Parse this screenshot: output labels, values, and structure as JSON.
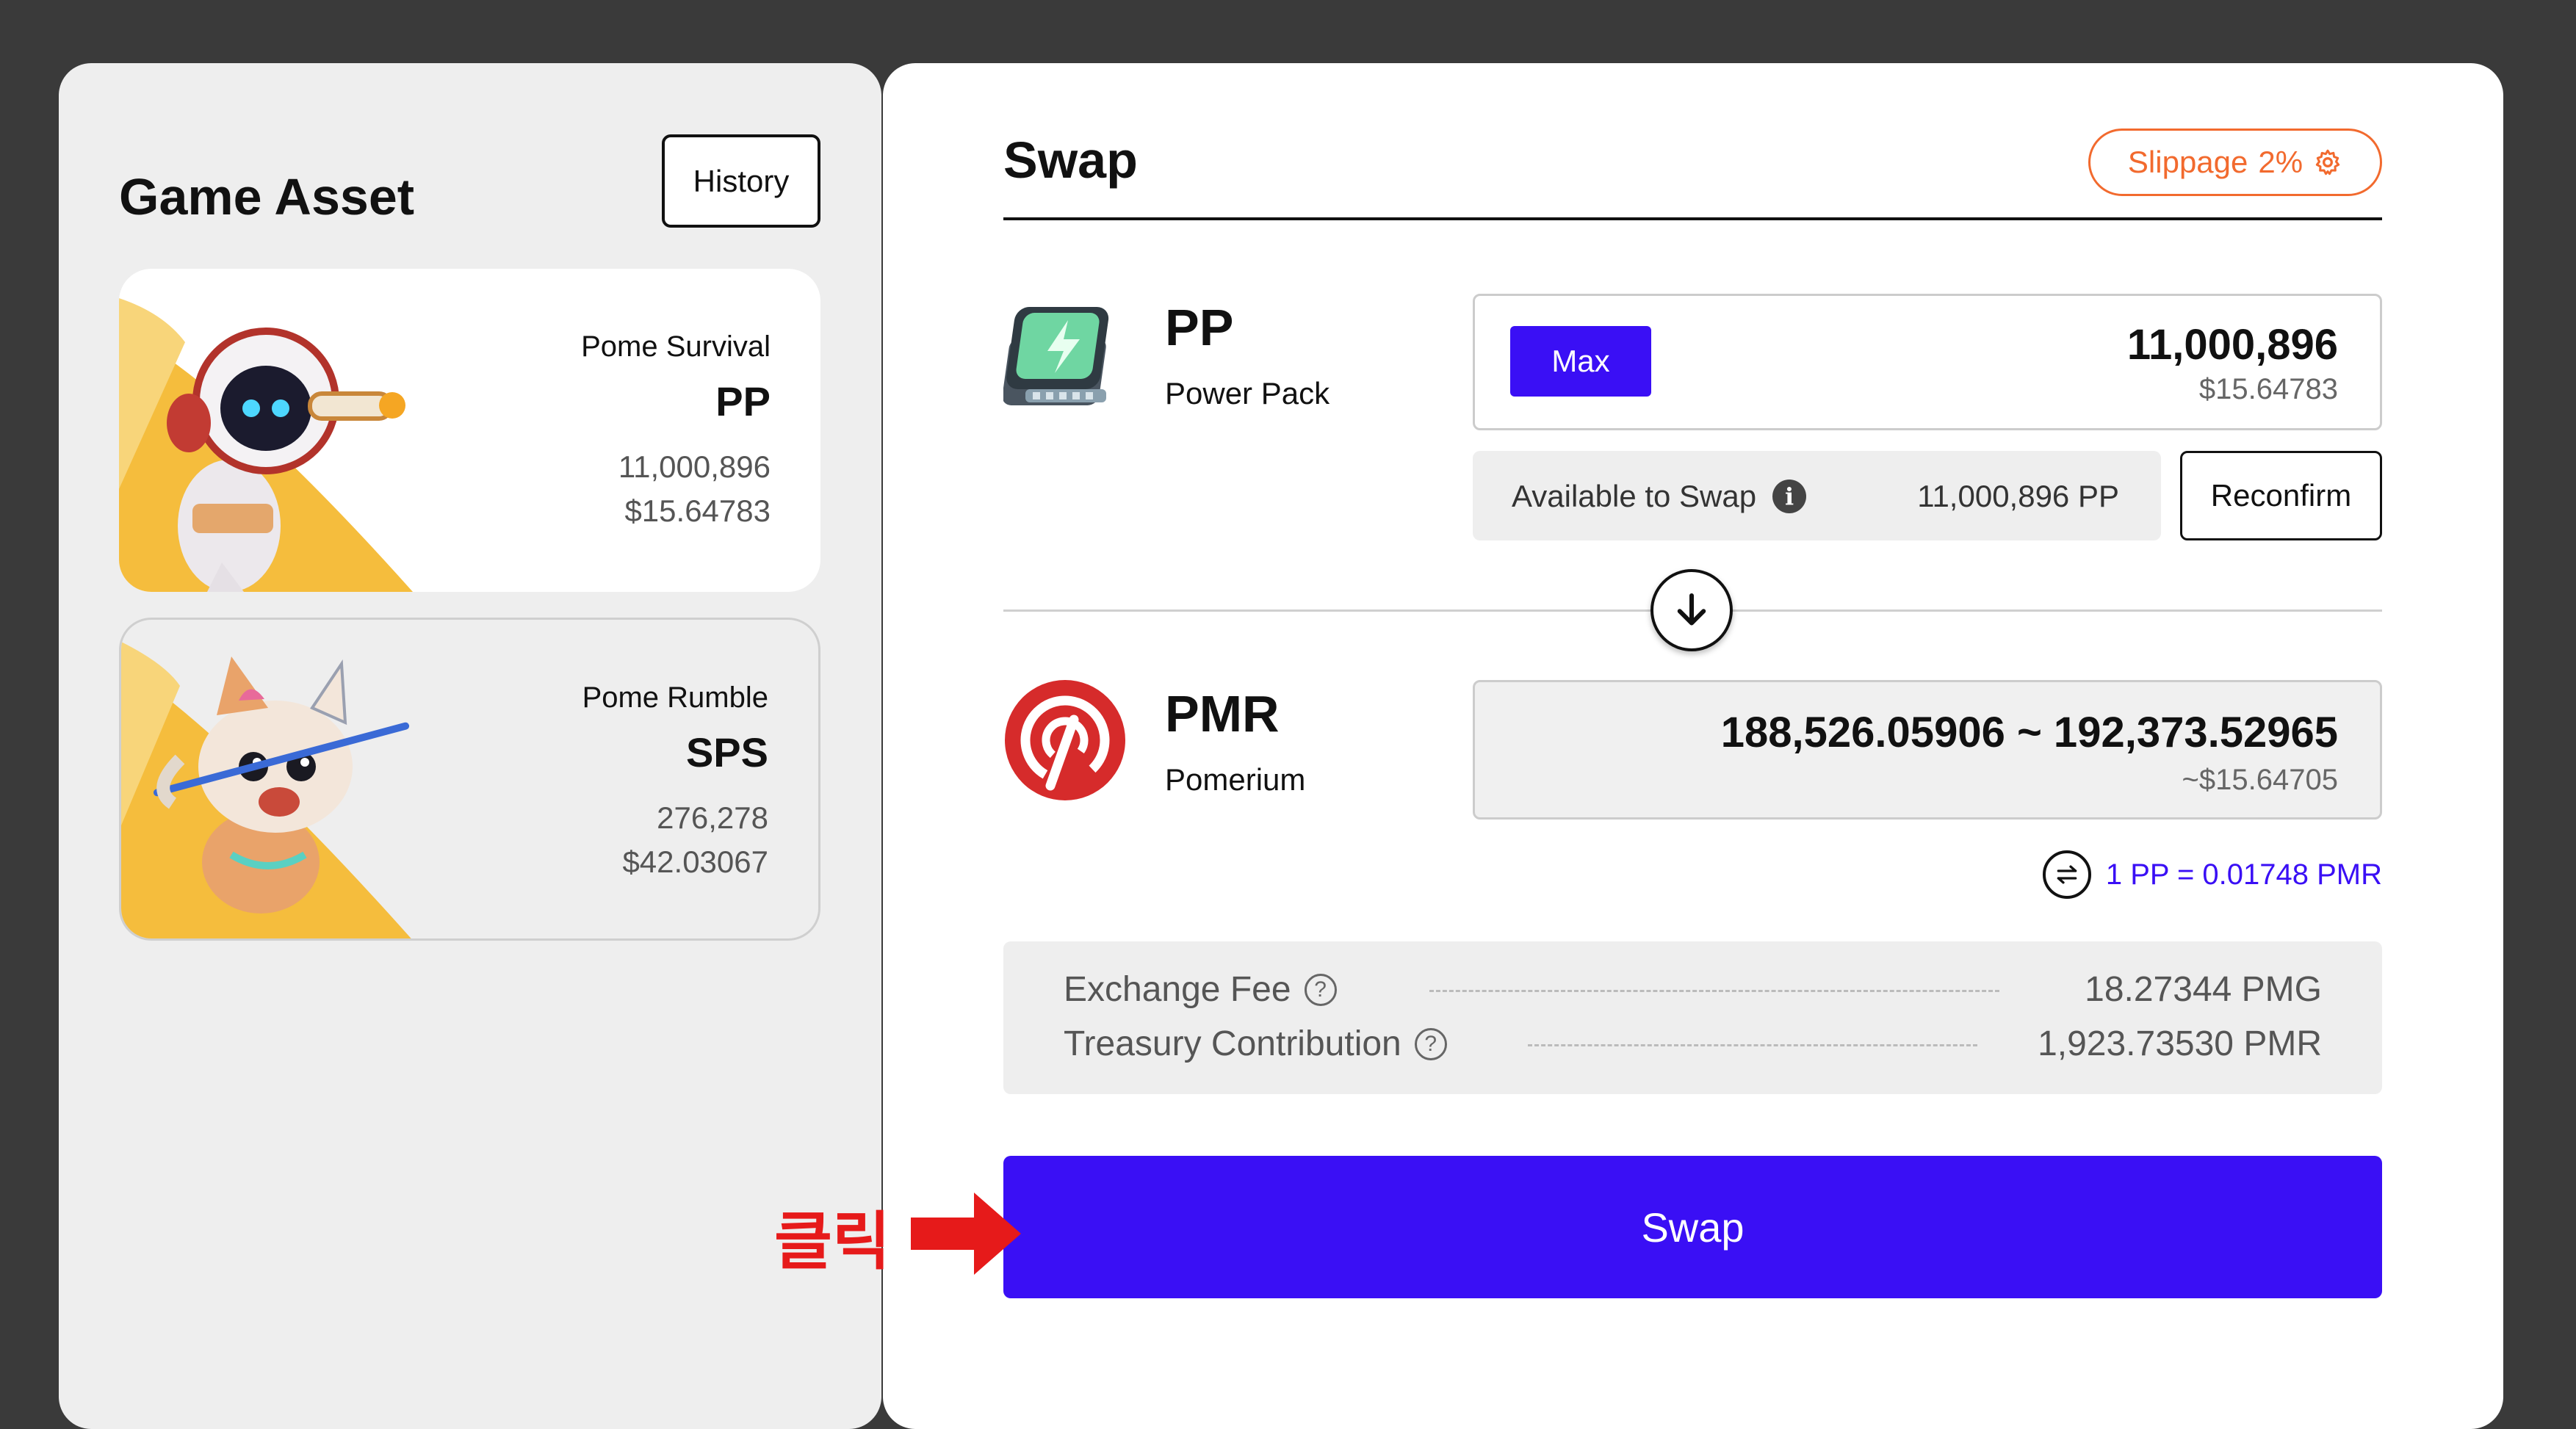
{
  "left": {
    "title": "Game Asset",
    "history_label": "History",
    "assets": [
      {
        "game": "Pome Survival",
        "ticker": "PP",
        "amount": "11,000,896",
        "usd": "$15.64783"
      },
      {
        "game": "Pome Rumble",
        "ticker": "SPS",
        "amount": "276,278",
        "usd": "$42.03067"
      }
    ]
  },
  "swap": {
    "title": "Swap",
    "slippage_label": "Slippage",
    "slippage_value": "2%",
    "from": {
      "symbol": "PP",
      "name": "Power Pack",
      "max_label": "Max",
      "amount": "11,000,896",
      "usd": "$15.64783",
      "available_label": "Available to Swap",
      "available_value": "11,000,896 PP",
      "reconfirm_label": "Reconfirm"
    },
    "to": {
      "symbol": "PMR",
      "name": "Pomerium",
      "amount": "188,526.05906 ~ 192,373.52965",
      "usd": "~$15.64705"
    },
    "rate": "1 PP = 0.01748 PMR",
    "fees": [
      {
        "label": "Exchange Fee",
        "value": "18.27344 PMG"
      },
      {
        "label": "Treasury Contribution",
        "value": "1,923.73530 PMR"
      }
    ],
    "swap_button": "Swap"
  },
  "annotation": {
    "click_text": "클릭"
  },
  "colors": {
    "accent": "#3a0ff5",
    "slippage": "#f26a2e",
    "annotation": "#e61a1a",
    "pmr_red": "#d62b2b"
  }
}
